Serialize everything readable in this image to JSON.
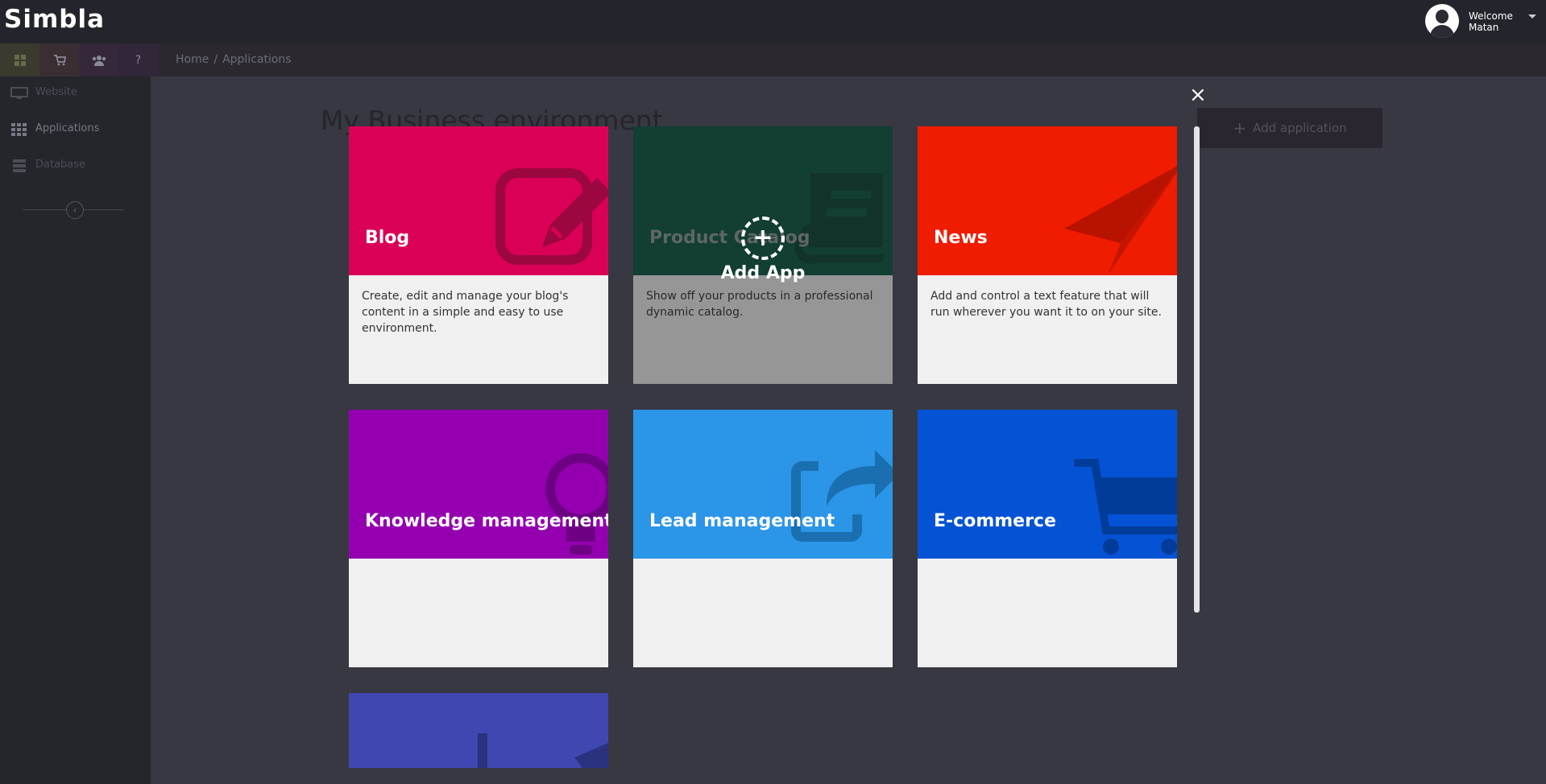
{
  "topbar": {
    "logo": "Simbla",
    "welcome_line1": "Welcome",
    "welcome_line2": "Matan"
  },
  "quickbar": {
    "icons": [
      "dashboard-icon",
      "cart-icon",
      "users-icon",
      "help-icon"
    ],
    "colors": [
      "#3b3a2e",
      "#3a2e33",
      "#35283a",
      "#32263a"
    ],
    "help_label": "?"
  },
  "breadcrumb": {
    "home": "Home",
    "sep": "/",
    "current": "Applications"
  },
  "sidebar": {
    "items": [
      {
        "label": "Website"
      },
      {
        "label": "Applications"
      },
      {
        "label": "Database"
      }
    ],
    "collapse_icon": "chevron-left-icon"
  },
  "page": {
    "title": "My Business environment",
    "add_application": "Add application"
  },
  "modal": {
    "close": "×",
    "add_app_label": "Add App",
    "add_app_plus": "+",
    "apps": [
      {
        "name": "Blog",
        "color": "#da0056",
        "description": "Create, edit and manage your blog's content in a simple and easy to use environment.",
        "icon": "pencil-icon"
      },
      {
        "name": "Product Catalog",
        "color": "#00513f",
        "description": "Show off your products in a professional dynamic catalog.",
        "icon": "book-icon"
      },
      {
        "name": "News",
        "color": "#ef1c00",
        "description": "Add and control a text feature that will run wherever you want it to on your site.",
        "icon": "paper-plane-icon"
      },
      {
        "name": "Knowledge management",
        "color": "#9400b0",
        "description": "",
        "icon": "lightbulb-icon"
      },
      {
        "name": "Lead management",
        "color": "#2b95e8",
        "description": "",
        "icon": "share-icon"
      },
      {
        "name": "E-commerce",
        "color": "#0553d5",
        "description": "",
        "icon": "cart-icon"
      },
      {
        "name": "",
        "color": "#3f48b1",
        "description": "",
        "icon": "chart-icon"
      }
    ]
  }
}
